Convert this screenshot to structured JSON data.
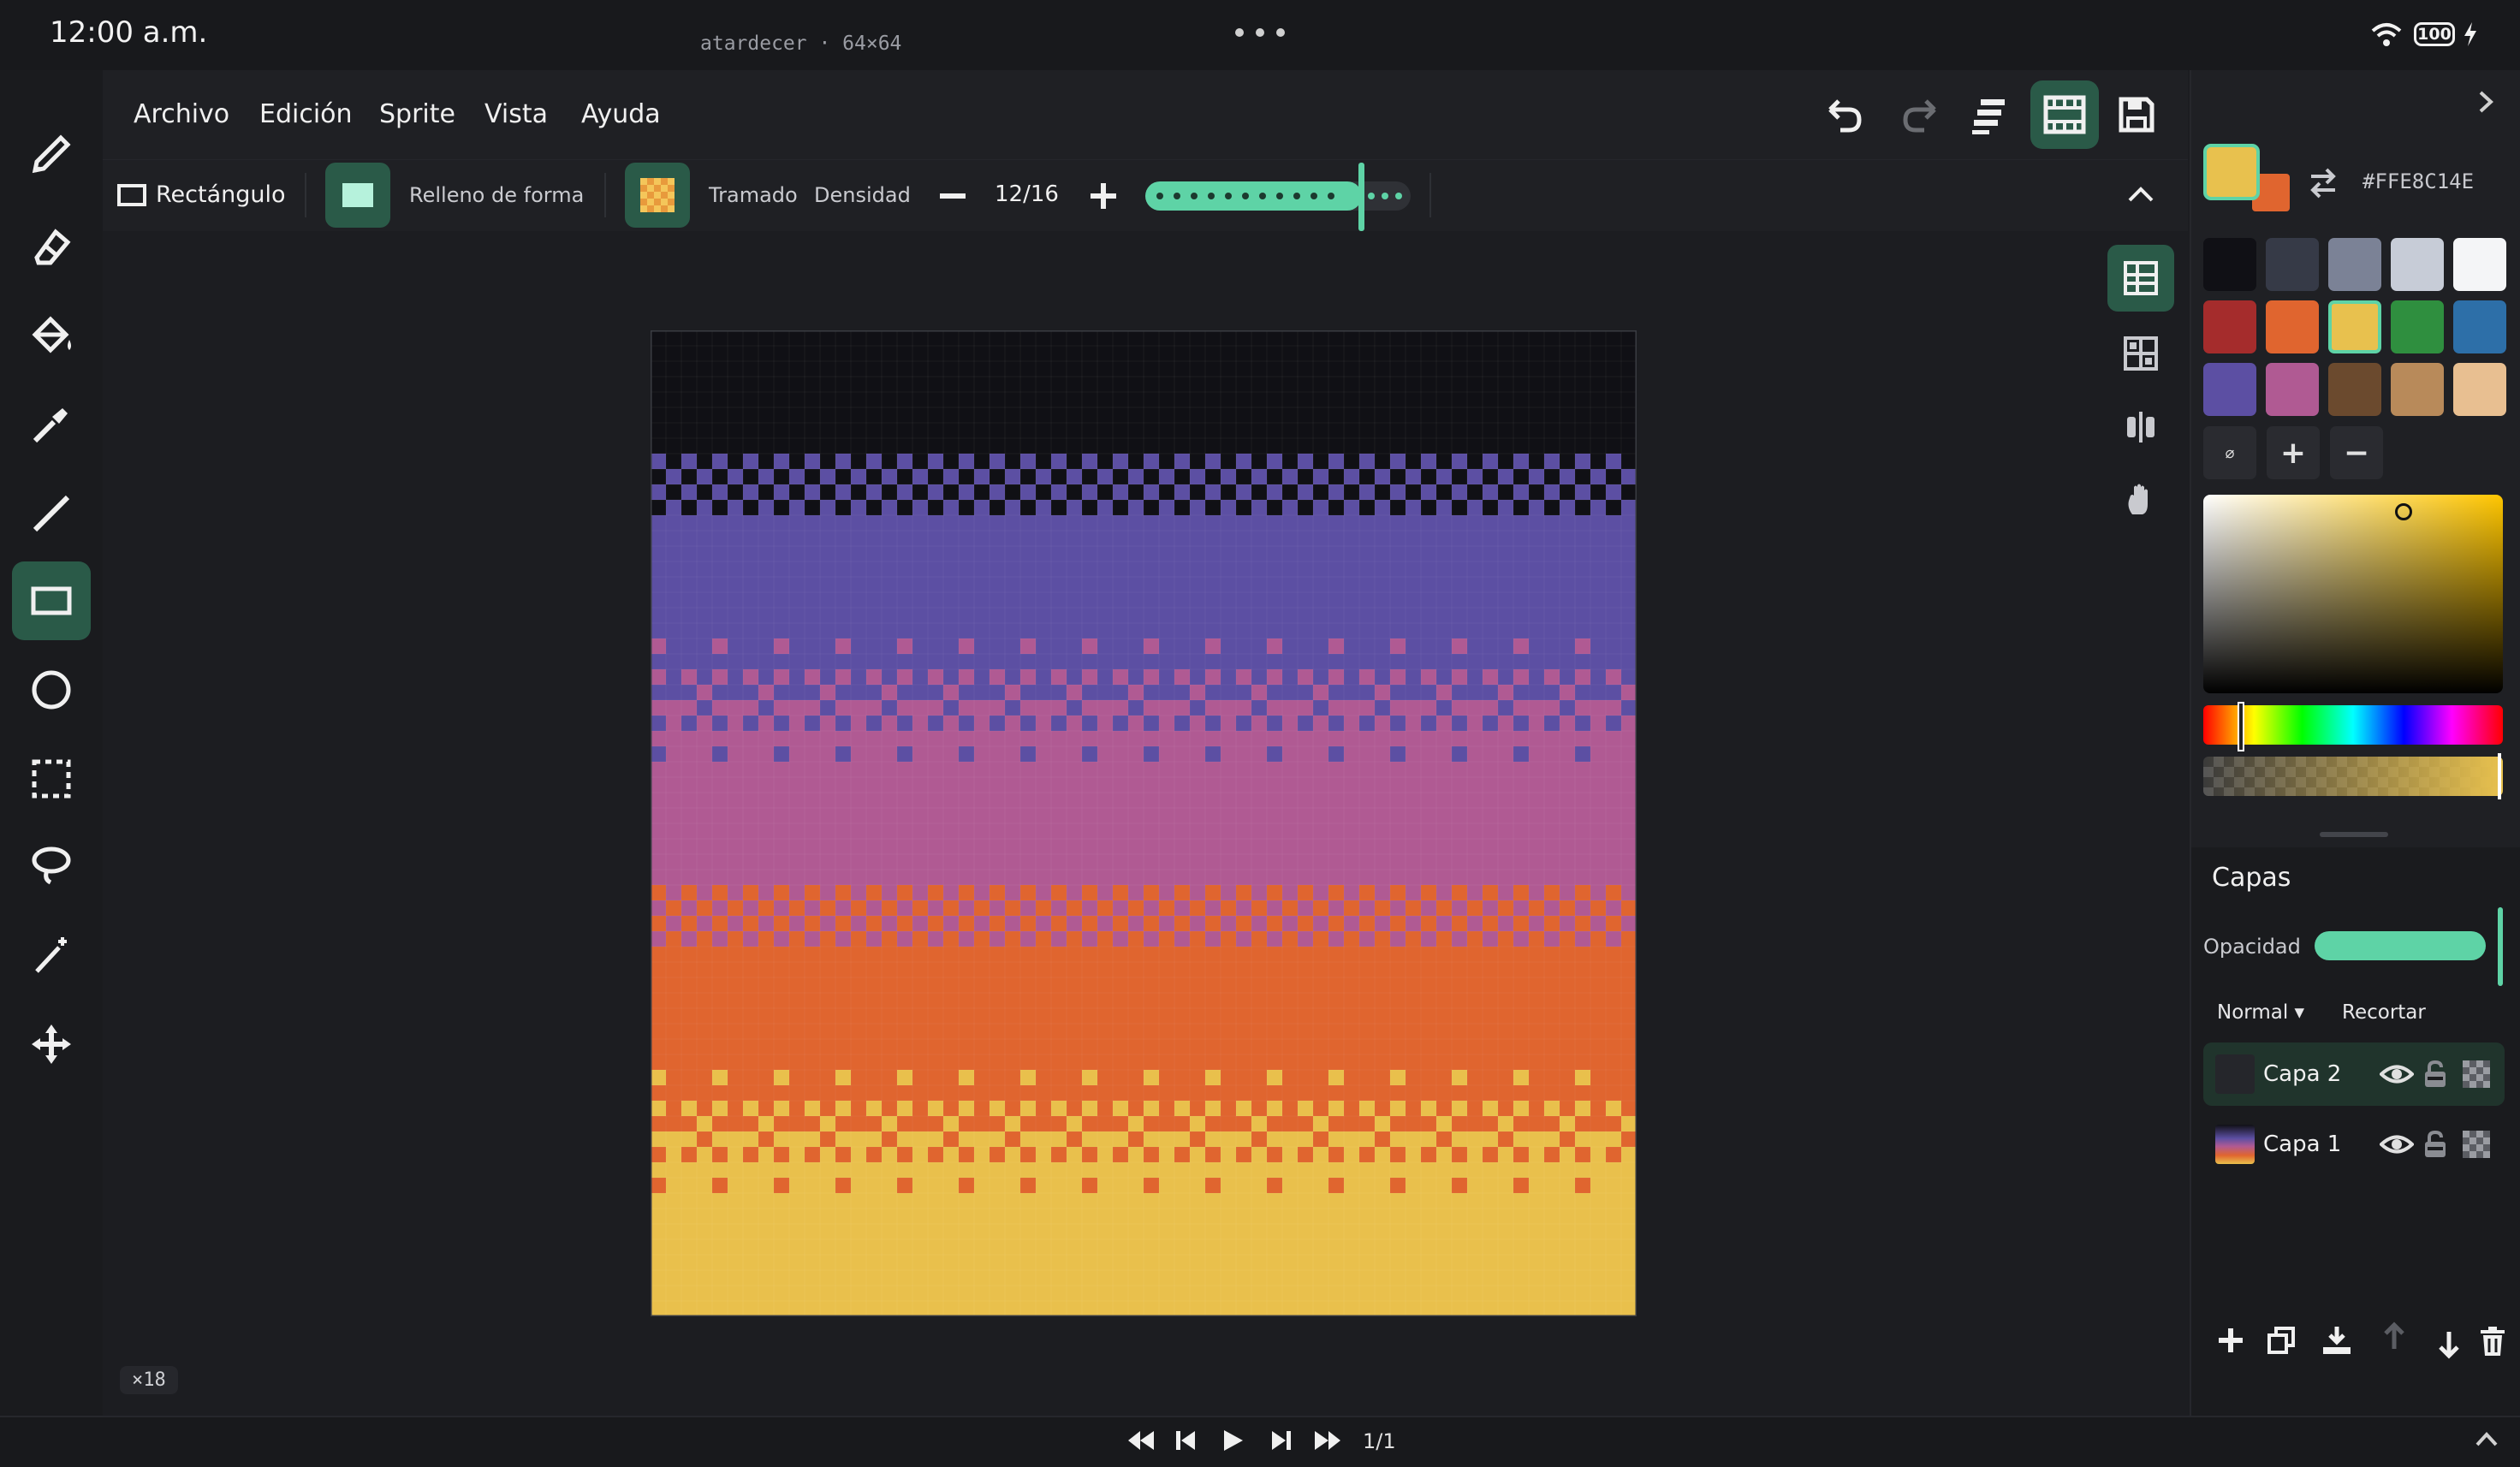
{
  "status_bar": {
    "time": "12:00 a.m.",
    "battery": "100"
  },
  "menu": {
    "items": [
      "Archivo",
      "Edición",
      "Sprite",
      "Vista",
      "Ayuda"
    ],
    "document": "atardecer · 64×64"
  },
  "tools": [
    "pencil-icon",
    "eraser-icon",
    "fill-bucket-icon",
    "eyedropper-icon",
    "line-icon",
    "rectangle-icon",
    "ellipse-icon",
    "marquee-select-icon",
    "lasso-icon",
    "magic-wand-icon",
    "move-icon"
  ],
  "active_tool": "rectangle-icon",
  "options": {
    "shape_label": "Rectángulo",
    "fill_label": "Relleno de forma",
    "dither_label": "Tramado",
    "density_label": "Densidad",
    "density_value": "12/16",
    "density_fraction": 0.75
  },
  "canvas": {
    "zoom": "×18",
    "gradient_bands": [
      {
        "from": "#101015",
        "to": "#101015"
      },
      {
        "from": "#101015",
        "to": "#5c4fa3"
      },
      {
        "from": "#5c4fa3",
        "to": "#5c4fa3"
      },
      {
        "from": "#5c4fa3",
        "to": "#b05a93"
      },
      {
        "from": "#b05a93",
        "to": "#b05a93"
      },
      {
        "from": "#b05a93",
        "to": "#e0652f"
      },
      {
        "from": "#e0652f",
        "to": "#e0652f"
      },
      {
        "from": "#e0652f",
        "to": "#e9c04c"
      },
      {
        "from": "#e9c04c",
        "to": "#e9c04c"
      }
    ]
  },
  "color": {
    "primary": "#E8C14E",
    "secondary": "#E0652F",
    "hex": "#FFE8C14E",
    "palette": [
      "#101015",
      "#363a47",
      "#7b8296",
      "#c7ccd7",
      "#f4f5f7",
      "#a52c2c",
      "#e0652f",
      "#e8c14e",
      "#2f8f3f",
      "#2d6fa8",
      "#5c4fa3",
      "#b05a93",
      "#6b4a2e",
      "#b88a5a",
      "#e8bf91"
    ],
    "selected_index": 7,
    "palette_actions": [
      "⌀",
      "+",
      "−"
    ]
  },
  "layers": {
    "title": "Capas",
    "opacity_label": "Opacidad",
    "opacity_value": 1.0,
    "blend_mode": "Normal ▾",
    "clip_label": "Recortar",
    "items": [
      {
        "name": "Capa 2",
        "active": true
      },
      {
        "name": "Capa 1",
        "active": false
      }
    ]
  },
  "timeline": {
    "frame": "1/1"
  }
}
